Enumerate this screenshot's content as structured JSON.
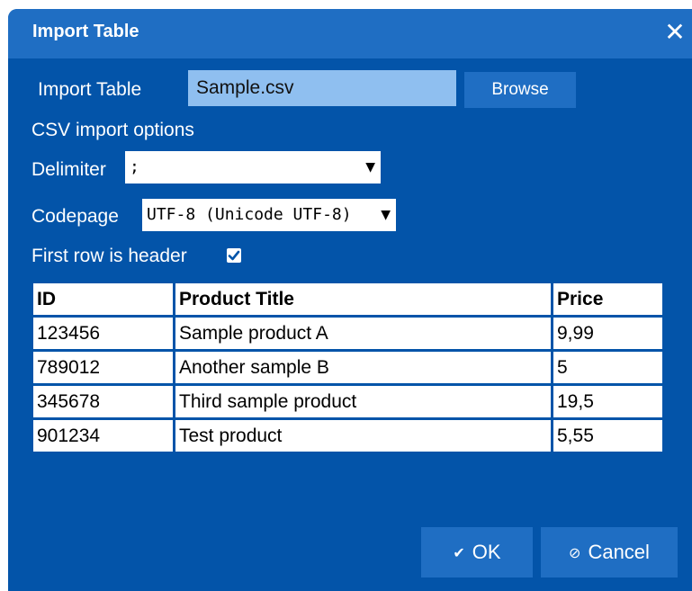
{
  "dialog": {
    "title": "Import Table",
    "close_glyph": "✕"
  },
  "import": {
    "label": "Import Table",
    "file_value": "Sample.csv",
    "browse_label": "Browse"
  },
  "csv_options": {
    "heading": "CSV import options",
    "delimiter_label": "Delimiter",
    "delimiter_value": ";",
    "codepage_label": "Codepage",
    "codepage_value": "UTF-8 (Unicode UTF-8)",
    "first_row_label": "First row is header",
    "first_row_checked": true,
    "caret_glyph": "▼"
  },
  "table": {
    "headers": [
      "ID",
      "Product Title",
      "Price"
    ],
    "rows": [
      [
        "123456",
        "Sample product A",
        "9,99"
      ],
      [
        "789012",
        "Another sample B",
        "5"
      ],
      [
        "345678",
        "Third sample product",
        "19,5"
      ],
      [
        "901234",
        "Test product",
        "5,55"
      ]
    ]
  },
  "buttons": {
    "ok_icon": "✔",
    "ok_label": "OK",
    "cancel_icon": "⊘",
    "cancel_label": "Cancel"
  },
  "colors": {
    "dialog_bg": "#0354a9",
    "titlebar_bg": "#1f6ec3",
    "button_bg": "#1f6ec3",
    "file_input_bg": "#8fbff0"
  },
  "icons": {
    "close": "close-icon",
    "dropdown": "chevron-down-icon",
    "checkbox": "checkmark-icon",
    "ok": "checkmark-icon",
    "cancel": "cancel-icon"
  }
}
